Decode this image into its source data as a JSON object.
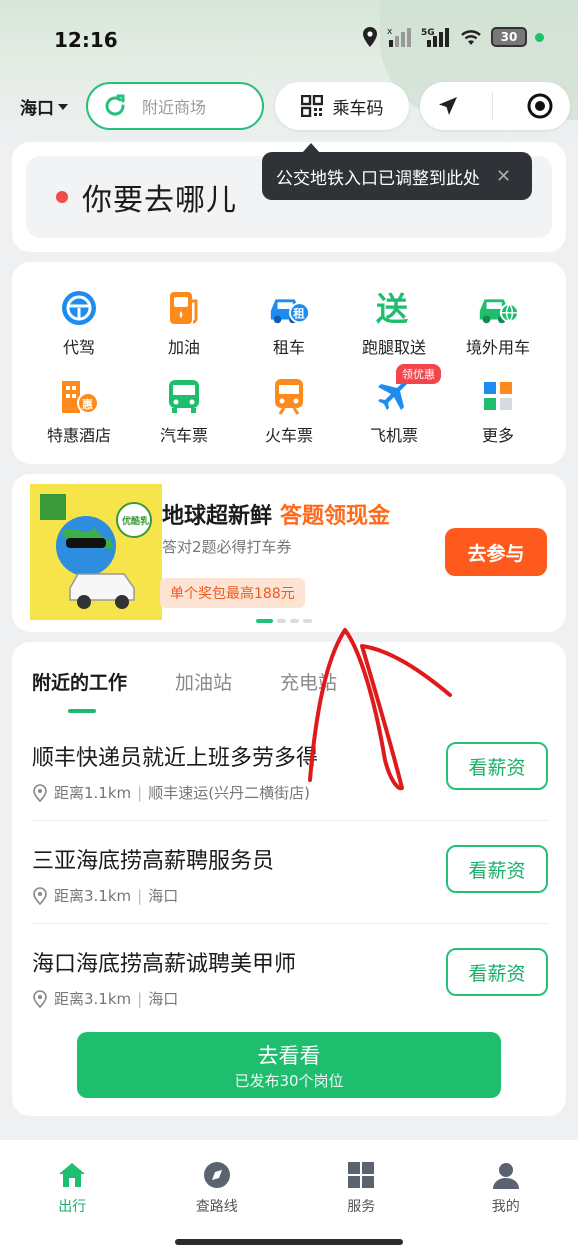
{
  "status_bar": {
    "time": "12:16",
    "battery": "30"
  },
  "top_bar": {
    "city": "海口",
    "search_placeholder": "附近商场",
    "ride_code": "乘车码"
  },
  "where": {
    "prompt": "你要去哪儿"
  },
  "tooltip": {
    "text": "公交地铁入口已调整到此处",
    "close": "✕"
  },
  "services": {
    "items": [
      {
        "label": "代驾",
        "icon": "steering-wheel-icon"
      },
      {
        "label": "加油",
        "icon": "fuel-pump-icon"
      },
      {
        "label": "租车",
        "icon": "rental-car-icon"
      },
      {
        "label": "跑腿取送",
        "icon": "delivery-icon"
      },
      {
        "label": "境外用车",
        "icon": "global-car-icon"
      },
      {
        "label": "特惠酒店",
        "icon": "hotel-icon"
      },
      {
        "label": "汽车票",
        "icon": "bus-icon"
      },
      {
        "label": "火车票",
        "icon": "train-icon"
      },
      {
        "label": "飞机票",
        "icon": "plane-icon"
      },
      {
        "label": "更多",
        "icon": "more-grid-icon"
      }
    ],
    "coupon_badge": "领优惠",
    "rent_badge": "租",
    "send_glyph": "送",
    "hotel_badge": "惠"
  },
  "promo": {
    "title": "地球超新鲜",
    "highlight": "答题领现金",
    "subtitle": "答对2题必得打车券",
    "tag": "单个奖包最高188元",
    "cta": "去参与",
    "art_badge": "优酷乳"
  },
  "jobs": {
    "tabs": [
      "附近的工作",
      "加油站",
      "充电站"
    ],
    "list": [
      {
        "title": "顺丰快递员就近上班多劳多得",
        "distance": "距离1.1km",
        "place": "顺丰速运(兴丹二横街店)",
        "action": "看薪资"
      },
      {
        "title": "三亚海底捞高薪聘服务员",
        "distance": "距离3.1km",
        "place": "海口",
        "action": "看薪资"
      },
      {
        "title": "海口海底捞高薪诚聘美甲师",
        "distance": "距离3.1km",
        "place": "海口",
        "action": "看薪资"
      }
    ],
    "go_button": {
      "main": "去看看",
      "sub": "已发布30个岗位"
    }
  },
  "bottom_nav": [
    {
      "label": "出行",
      "icon": "home-icon"
    },
    {
      "label": "查路线",
      "icon": "compass-icon"
    },
    {
      "label": "服务",
      "icon": "grid-icon"
    },
    {
      "label": "我的",
      "icon": "person-icon"
    }
  ],
  "colors": {
    "accent": "#1fbe6f",
    "orange": "#ff5a1e",
    "annotation": "#e0191b"
  }
}
